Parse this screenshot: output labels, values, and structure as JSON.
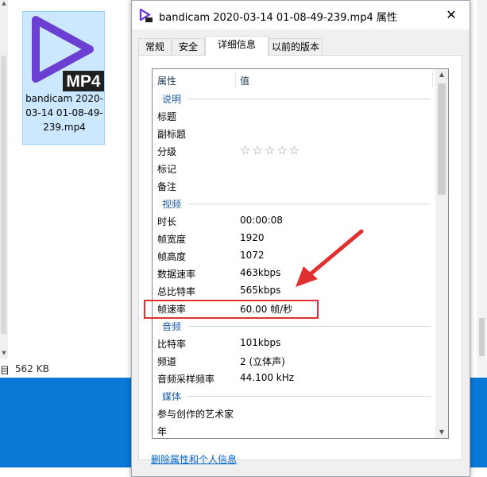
{
  "explorer": {
    "file": {
      "name": "bandicam 2020-03-14 01-08-49-239.mp4",
      "icon_badge": "MP4",
      "icon": "video-file-icon"
    },
    "status": {
      "selected_suffix": "目",
      "size": "562 KB"
    }
  },
  "dialog": {
    "title": "bandicam 2020-03-14 01-08-49-239.mp4 属性",
    "close_glyph": "✕",
    "tabs": [
      {
        "label": "常规",
        "active": false
      },
      {
        "label": "安全",
        "active": false
      },
      {
        "label": "详细信息",
        "active": true
      },
      {
        "label": "以前的版本",
        "active": false
      }
    ],
    "columns": {
      "name": "属性",
      "value": "值"
    },
    "groups": [
      {
        "name": "说明",
        "rows": [
          {
            "name": "标题",
            "value": ""
          },
          {
            "name": "副标题",
            "value": ""
          },
          {
            "name": "分级",
            "value": "☆☆☆☆☆",
            "rating": 0,
            "rating_max": 5
          },
          {
            "name": "标记",
            "value": ""
          },
          {
            "name": "备注",
            "value": ""
          }
        ]
      },
      {
        "name": "视频",
        "rows": [
          {
            "name": "时长",
            "value": "00:00:08"
          },
          {
            "name": "帧宽度",
            "value": "1920"
          },
          {
            "name": "帧高度",
            "value": "1072"
          },
          {
            "name": "数据速率",
            "value": "463kbps"
          },
          {
            "name": "总比特率",
            "value": "565kbps"
          },
          {
            "name": "帧速率",
            "value": "60.00 帧/秒"
          }
        ]
      },
      {
        "name": "音频",
        "rows": [
          {
            "name": "比特率",
            "value": "101kbps"
          },
          {
            "name": "频道",
            "value": "2 (立体声)"
          },
          {
            "name": "音频采样频率",
            "value": "44.100 kHz"
          }
        ]
      },
      {
        "name": "媒体",
        "rows": [
          {
            "name": "参与创作的艺术家",
            "value": ""
          },
          {
            "name": "年",
            "value": ""
          }
        ]
      }
    ],
    "remove_link": "删除属性和个人信息"
  },
  "annotation": {
    "color": "#e03030"
  },
  "colors": {
    "taskbar": "#0a78d7",
    "selection": "#cce8ff",
    "group_header": "#1e5aa8",
    "link": "#0066cc"
  }
}
